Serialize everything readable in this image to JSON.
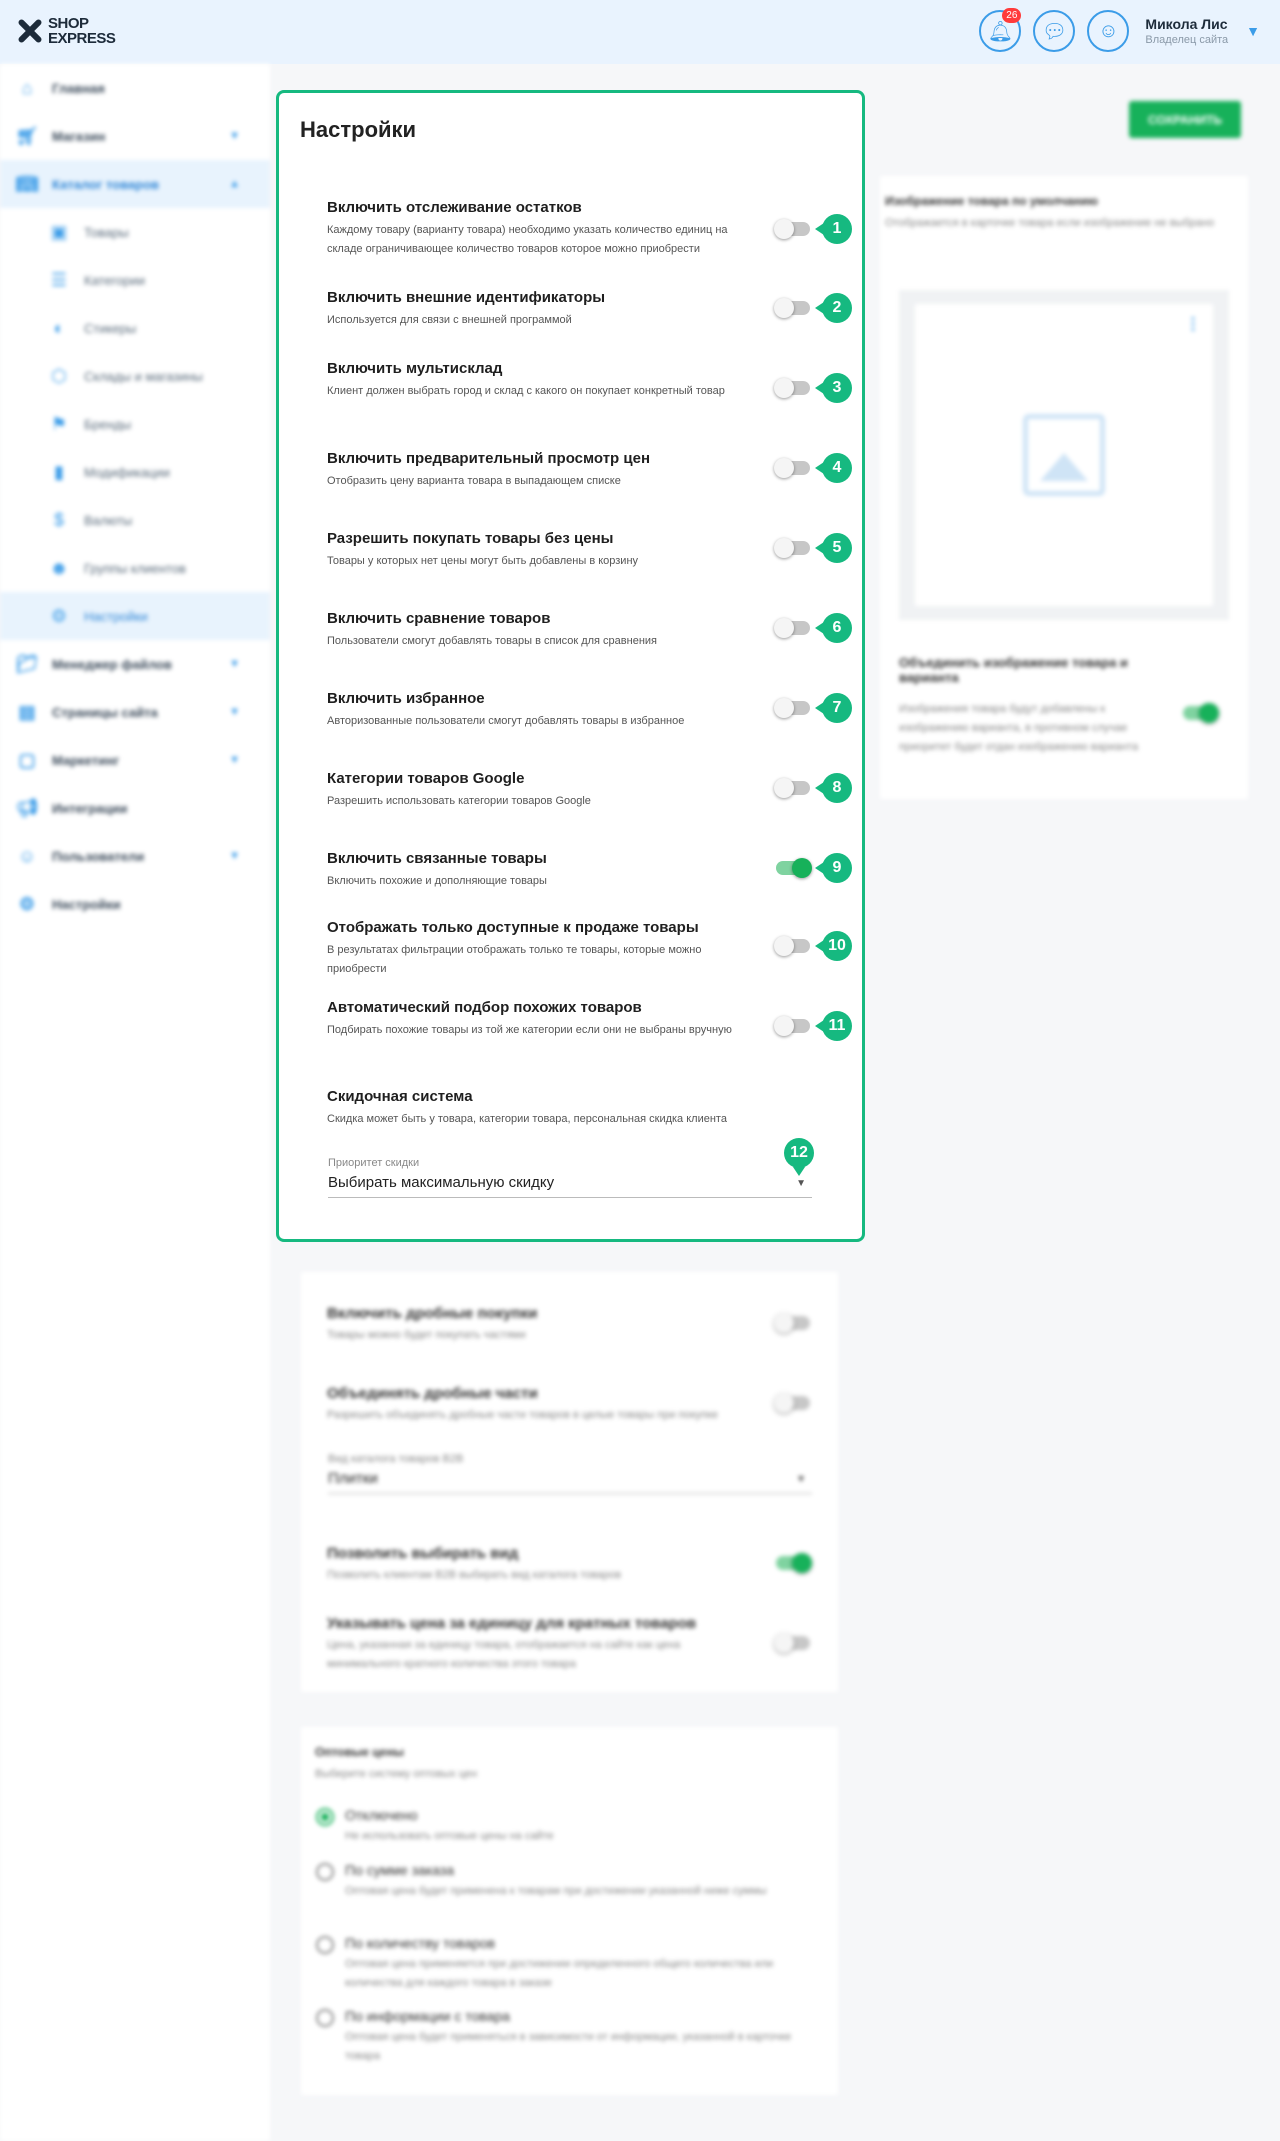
{
  "header": {
    "logo_line1": "SHOP",
    "logo_line2": "EXPRESS",
    "notif_count": "26",
    "user_name": "Микола Лис",
    "user_role": "Владелец сайта"
  },
  "sidebar": {
    "items": [
      {
        "label": "Главная",
        "icon": "home-icon"
      },
      {
        "label": "Магазин",
        "icon": "cart-icon"
      },
      {
        "label": "Каталог товаров",
        "icon": "book-icon"
      },
      {
        "label": "Товары",
        "icon": "box-icon"
      },
      {
        "label": "Категории",
        "icon": "list-icon"
      },
      {
        "label": "Стикеры",
        "icon": "sticker-icon"
      },
      {
        "label": "Склады и магазины",
        "icon": "warehouse-icon"
      },
      {
        "label": "Бренды",
        "icon": "tag-icon"
      },
      {
        "label": "Модификации",
        "icon": "bookmark-icon"
      },
      {
        "label": "Валюты",
        "icon": "currency-icon"
      },
      {
        "label": "Группы клиентов",
        "icon": "group-icon"
      },
      {
        "label": "Настройки",
        "icon": "gear-icon"
      },
      {
        "label": "Менеджер файлов",
        "icon": "folder-icon"
      },
      {
        "label": "Страницы сайта",
        "icon": "pages-icon"
      },
      {
        "label": "Маркетинг",
        "icon": "marketing-icon"
      },
      {
        "label": "Интеграции",
        "icon": "megaphone-icon"
      },
      {
        "label": "Пользователи",
        "icon": "user-icon"
      },
      {
        "label": "Настройки",
        "icon": "gear-icon"
      }
    ]
  },
  "main": {
    "title": "Настройки",
    "save_label": "СОХРАНИТЬ",
    "settings": [
      {
        "title": "Включить отслеживание остатков",
        "desc": "Каждому товару (варианту товара) необходимо указать количество единиц на складе ограничивающее количество товаров которое можно приобрести",
        "on": false,
        "marker": "1"
      },
      {
        "title": "Включить внешние идентификаторы",
        "desc": "Используется для связи с внешней программой",
        "on": false,
        "marker": "2"
      },
      {
        "title": "Включить мультисклад",
        "desc": "Клиент должен выбрать город и склад с какого он покупает конкретный товар",
        "on": false,
        "marker": "3"
      },
      {
        "title": "Включить предварительный просмотр цен",
        "desc": "Отобразить цену варианта товара в выпадающем списке",
        "on": false,
        "marker": "4"
      },
      {
        "title": "Разрешить покупать товары без цены",
        "desc": "Товары у которых нет цены могут быть добавлены в корзину",
        "on": false,
        "marker": "5"
      },
      {
        "title": "Включить сравнение товаров",
        "desc": "Пользователи смогут добавлять товары в список для сравнения",
        "on": false,
        "marker": "6"
      },
      {
        "title": "Включить избранное",
        "desc": "Авторизованные пользователи смогут добавлять товары в избранное",
        "on": false,
        "marker": "7"
      },
      {
        "title": "Категории товаров Google",
        "desc": "Разрешить использовать категории товаров Google",
        "on": false,
        "marker": "8"
      },
      {
        "title": "Включить связанные товары",
        "desc": "Включить похожие и дополняющие товары",
        "on": true,
        "marker": "9"
      },
      {
        "title": "Отображать только доступные к продаже товары",
        "desc": "В результатах фильтрации отображать только те товары, которые можно приобрести",
        "on": false,
        "marker": "10"
      },
      {
        "title": "Автоматический подбор похожих товаров",
        "desc": "Подбирать похожие товары из той же категории если они не выбраны вручную",
        "on": false,
        "marker": "11"
      }
    ],
    "discount": {
      "title": "Скидочная система",
      "desc": "Скидка может быть у товара, категории товара, персональная скидка клиента",
      "select_label": "Приоритет скидки",
      "select_value": "Выбирать максимальную скидку",
      "marker": "12"
    }
  },
  "fractional": {
    "s1_title": "Включить дробные покупки",
    "s1_desc": "Товары можно будет покупать частями",
    "s2_title": "Объединять дробные части",
    "s2_desc": "Разрешить объединять дробные части товаров в целые товары при покупке",
    "select_label": "Вид каталога товаров B2B",
    "select_value": "Плитки",
    "s3_title": "Позволить выбирать вид",
    "s3_desc": "Позволить клиентам B2B выбирать вид каталога товаров",
    "s4_title": "Указывать цена за единицу для кратных товаров",
    "s4_desc": "Цена, указанная за единицу товара, отображается на сайте как цена минимального кратного количества этого товара"
  },
  "wholesale": {
    "title": "Оптовые цены",
    "desc": "Выберите систему оптовых цен",
    "options": [
      {
        "label": "Отключено",
        "desc": "Не использовать оптовые цены на сайте",
        "selected": true
      },
      {
        "label": "По сумме заказа",
        "desc": "Оптовая цена будет применена к товарам при достижении указанной ниже суммы",
        "selected": false
      },
      {
        "label": "По количеству товаров",
        "desc": "Оптовая цена применяется при достижении определенного общего количества или количества для каждого товара в заказе",
        "selected": false
      },
      {
        "label": "По информации с товара",
        "desc": "Оптовая цена будет применяться в зависимости от информации, указанной в карточке товара",
        "selected": false
      }
    ]
  },
  "right": {
    "img_title": "Изображение товара по умолчанию",
    "img_desc": "Отображается в карточке товара если изображение не выбрано",
    "merge_title": "Объединить изображение товара и варианта",
    "merge_desc": "Изображения товара будут добавлены к изображению варианта, в противном случае приоритет будет отдан изображению варианта"
  }
}
